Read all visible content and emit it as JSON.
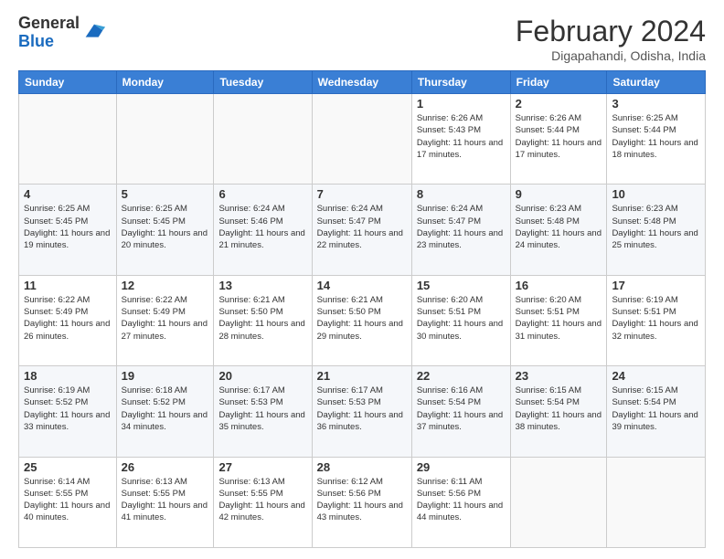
{
  "logo": {
    "general": "General",
    "blue": "Blue"
  },
  "title": "February 2024",
  "location": "Digapahandi, Odisha, India",
  "days_of_week": [
    "Sunday",
    "Monday",
    "Tuesday",
    "Wednesday",
    "Thursday",
    "Friday",
    "Saturday"
  ],
  "weeks": [
    [
      {
        "day": "",
        "info": ""
      },
      {
        "day": "",
        "info": ""
      },
      {
        "day": "",
        "info": ""
      },
      {
        "day": "",
        "info": ""
      },
      {
        "day": "1",
        "info": "Sunrise: 6:26 AM\nSunset: 5:43 PM\nDaylight: 11 hours and 17 minutes."
      },
      {
        "day": "2",
        "info": "Sunrise: 6:26 AM\nSunset: 5:44 PM\nDaylight: 11 hours and 17 minutes."
      },
      {
        "day": "3",
        "info": "Sunrise: 6:25 AM\nSunset: 5:44 PM\nDaylight: 11 hours and 18 minutes."
      }
    ],
    [
      {
        "day": "4",
        "info": "Sunrise: 6:25 AM\nSunset: 5:45 PM\nDaylight: 11 hours and 19 minutes."
      },
      {
        "day": "5",
        "info": "Sunrise: 6:25 AM\nSunset: 5:45 PM\nDaylight: 11 hours and 20 minutes."
      },
      {
        "day": "6",
        "info": "Sunrise: 6:24 AM\nSunset: 5:46 PM\nDaylight: 11 hours and 21 minutes."
      },
      {
        "day": "7",
        "info": "Sunrise: 6:24 AM\nSunset: 5:47 PM\nDaylight: 11 hours and 22 minutes."
      },
      {
        "day": "8",
        "info": "Sunrise: 6:24 AM\nSunset: 5:47 PM\nDaylight: 11 hours and 23 minutes."
      },
      {
        "day": "9",
        "info": "Sunrise: 6:23 AM\nSunset: 5:48 PM\nDaylight: 11 hours and 24 minutes."
      },
      {
        "day": "10",
        "info": "Sunrise: 6:23 AM\nSunset: 5:48 PM\nDaylight: 11 hours and 25 minutes."
      }
    ],
    [
      {
        "day": "11",
        "info": "Sunrise: 6:22 AM\nSunset: 5:49 PM\nDaylight: 11 hours and 26 minutes."
      },
      {
        "day": "12",
        "info": "Sunrise: 6:22 AM\nSunset: 5:49 PM\nDaylight: 11 hours and 27 minutes."
      },
      {
        "day": "13",
        "info": "Sunrise: 6:21 AM\nSunset: 5:50 PM\nDaylight: 11 hours and 28 minutes."
      },
      {
        "day": "14",
        "info": "Sunrise: 6:21 AM\nSunset: 5:50 PM\nDaylight: 11 hours and 29 minutes."
      },
      {
        "day": "15",
        "info": "Sunrise: 6:20 AM\nSunset: 5:51 PM\nDaylight: 11 hours and 30 minutes."
      },
      {
        "day": "16",
        "info": "Sunrise: 6:20 AM\nSunset: 5:51 PM\nDaylight: 11 hours and 31 minutes."
      },
      {
        "day": "17",
        "info": "Sunrise: 6:19 AM\nSunset: 5:51 PM\nDaylight: 11 hours and 32 minutes."
      }
    ],
    [
      {
        "day": "18",
        "info": "Sunrise: 6:19 AM\nSunset: 5:52 PM\nDaylight: 11 hours and 33 minutes."
      },
      {
        "day": "19",
        "info": "Sunrise: 6:18 AM\nSunset: 5:52 PM\nDaylight: 11 hours and 34 minutes."
      },
      {
        "day": "20",
        "info": "Sunrise: 6:17 AM\nSunset: 5:53 PM\nDaylight: 11 hours and 35 minutes."
      },
      {
        "day": "21",
        "info": "Sunrise: 6:17 AM\nSunset: 5:53 PM\nDaylight: 11 hours and 36 minutes."
      },
      {
        "day": "22",
        "info": "Sunrise: 6:16 AM\nSunset: 5:54 PM\nDaylight: 11 hours and 37 minutes."
      },
      {
        "day": "23",
        "info": "Sunrise: 6:15 AM\nSunset: 5:54 PM\nDaylight: 11 hours and 38 minutes."
      },
      {
        "day": "24",
        "info": "Sunrise: 6:15 AM\nSunset: 5:54 PM\nDaylight: 11 hours and 39 minutes."
      }
    ],
    [
      {
        "day": "25",
        "info": "Sunrise: 6:14 AM\nSunset: 5:55 PM\nDaylight: 11 hours and 40 minutes."
      },
      {
        "day": "26",
        "info": "Sunrise: 6:13 AM\nSunset: 5:55 PM\nDaylight: 11 hours and 41 minutes."
      },
      {
        "day": "27",
        "info": "Sunrise: 6:13 AM\nSunset: 5:55 PM\nDaylight: 11 hours and 42 minutes."
      },
      {
        "day": "28",
        "info": "Sunrise: 6:12 AM\nSunset: 5:56 PM\nDaylight: 11 hours and 43 minutes."
      },
      {
        "day": "29",
        "info": "Sunrise: 6:11 AM\nSunset: 5:56 PM\nDaylight: 11 hours and 44 minutes."
      },
      {
        "day": "",
        "info": ""
      },
      {
        "day": "",
        "info": ""
      }
    ]
  ]
}
